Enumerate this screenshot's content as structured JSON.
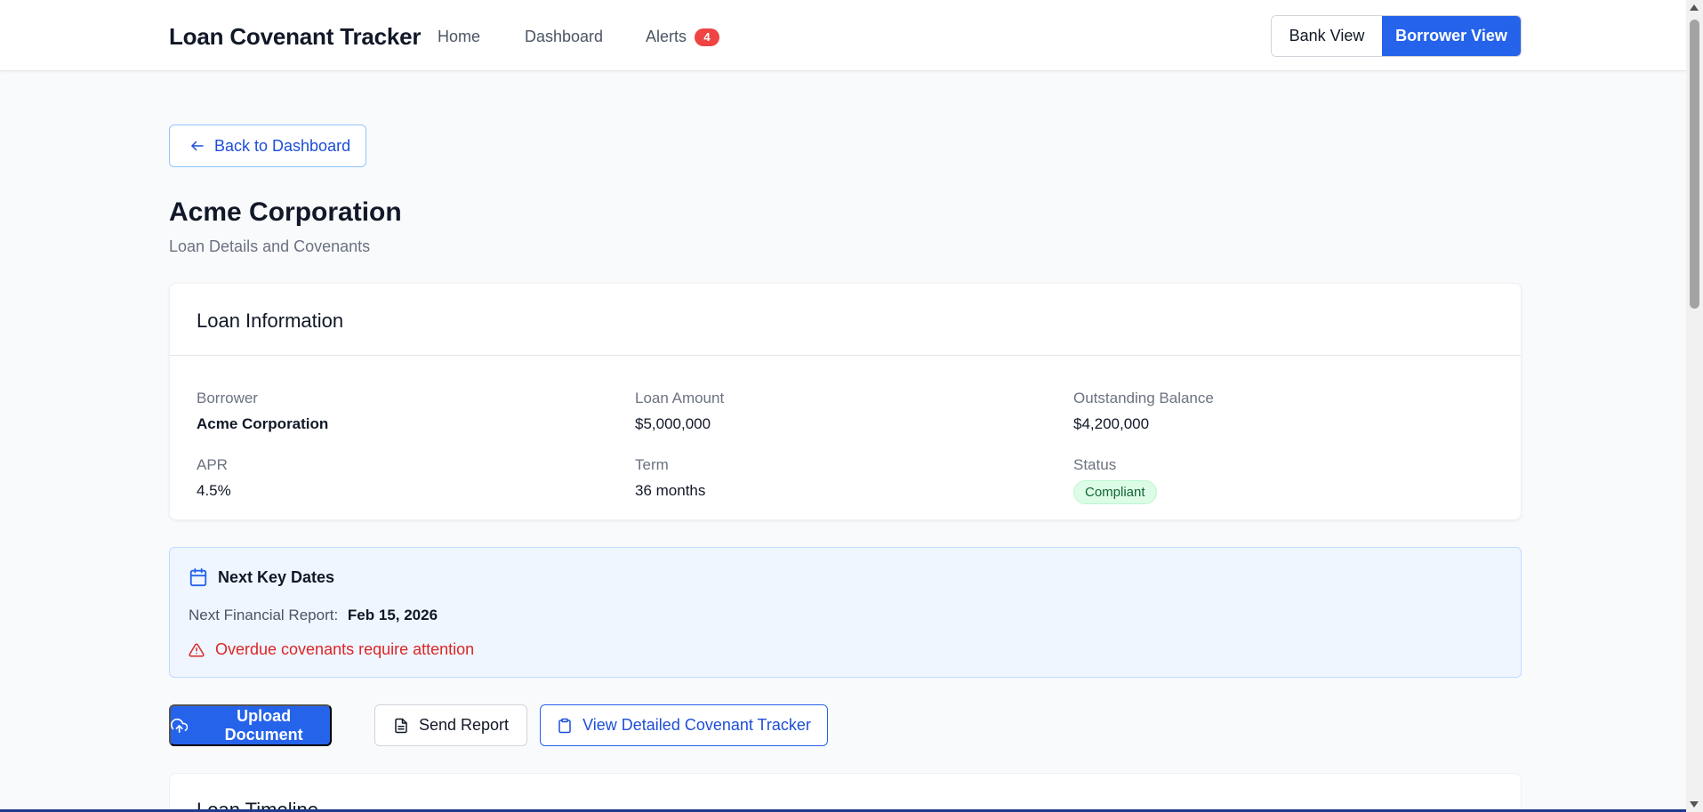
{
  "header": {
    "brand": "Loan Covenant Tracker",
    "nav": {
      "home": "Home",
      "dashboard": "Dashboard",
      "alerts": "Alerts",
      "alerts_count": "4"
    },
    "view_toggle": {
      "bank": "Bank View",
      "borrower": "Borrower View",
      "active": "Borrower View"
    }
  },
  "back_button": "Back to Dashboard",
  "page": {
    "title": "Acme Corporation",
    "subtitle": "Loan Details and Covenants"
  },
  "loan_info": {
    "heading": "Loan Information",
    "borrower_label": "Borrower",
    "borrower_value": "Acme Corporation",
    "amount_label": "Loan Amount",
    "amount_value": "$5,000,000",
    "balance_label": "Outstanding Balance",
    "balance_value": "$4,200,000",
    "apr_label": "APR",
    "apr_value": "4.5%",
    "term_label": "Term",
    "term_value": "36 months",
    "status_label": "Status",
    "status_value": "Compliant"
  },
  "key_dates": {
    "heading": "Next Key Dates",
    "report_label": "Next Financial Report:",
    "report_value": "Feb 15, 2026",
    "alert": "Overdue covenants require attention"
  },
  "actions": {
    "upload": "Upload Document",
    "send": "Send Report",
    "view": "View Detailed Covenant Tracker"
  },
  "timeline": {
    "heading": "Loan Timeline"
  },
  "colors": {
    "primary": "#2563eb",
    "danger": "#dc2626",
    "success_bg": "#dcfce7",
    "info_bg": "#eff6ff"
  }
}
